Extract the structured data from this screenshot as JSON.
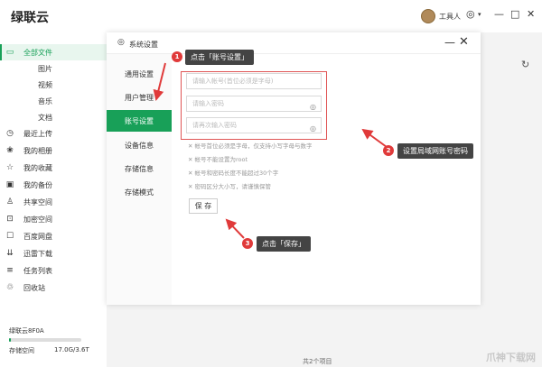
{
  "app": {
    "title": "绿联云"
  },
  "user": {
    "name": "工具人"
  },
  "window_controls": {
    "settings": "◎",
    "minimize": "—",
    "maximize": "□",
    "close": "✕"
  },
  "sidebar": {
    "items": [
      {
        "label": "全部文件",
        "icon": "folder-icon"
      },
      {
        "label": "图片",
        "icon": ""
      },
      {
        "label": "视频",
        "icon": ""
      },
      {
        "label": "音乐",
        "icon": ""
      },
      {
        "label": "文档",
        "icon": ""
      },
      {
        "label": "最近上传",
        "icon": "clock-icon"
      },
      {
        "label": "我的相册",
        "icon": "album-icon"
      },
      {
        "label": "我的收藏",
        "icon": "star-icon"
      },
      {
        "label": "我的备份",
        "icon": "backup-icon"
      },
      {
        "label": "共享空间",
        "icon": "share-icon"
      },
      {
        "label": "加密空间",
        "icon": "lock-icon"
      },
      {
        "label": "百度网盘",
        "icon": "cloud-icon"
      },
      {
        "label": "迅雷下载",
        "icon": "download-icon"
      },
      {
        "label": "任务列表",
        "icon": "list-icon"
      },
      {
        "label": "回收站",
        "icon": "trash-icon"
      }
    ],
    "device": "绿联云8F0A",
    "storage_label": "存储空间",
    "storage_value": "17.0G/3.6T",
    "storage_fraction": 0.005
  },
  "footer": {
    "status": "共2个项目"
  },
  "dialog": {
    "title": "系统设置",
    "nav": [
      "通用设置",
      "用户管理",
      "账号设置",
      "设备信息",
      "存储信息",
      "存储模式"
    ],
    "account_placeholder": "请输入帐号(首位必须是字母)",
    "password_placeholder": "请输入密码",
    "confirm_placeholder": "请再次输入密码",
    "rules": [
      "帐号首位必须是字母，仅支持小写字母与数字",
      "帐号不能设置为root",
      "帐号和密码长度不能超过30个字",
      "密码区分大小写，请谨慎保管"
    ],
    "save_label": "保 存"
  },
  "callouts": {
    "step1": "点击「账号设置」",
    "step2": "设置局域网账号密码",
    "step3": "点击「保存」",
    "badge1": "1",
    "badge2": "2",
    "badge3": "3"
  },
  "watermark": "爪神下载网",
  "colors": {
    "accent": "#18a058",
    "callout_bg": "#444444",
    "annotation_red": "#e03a3a"
  }
}
